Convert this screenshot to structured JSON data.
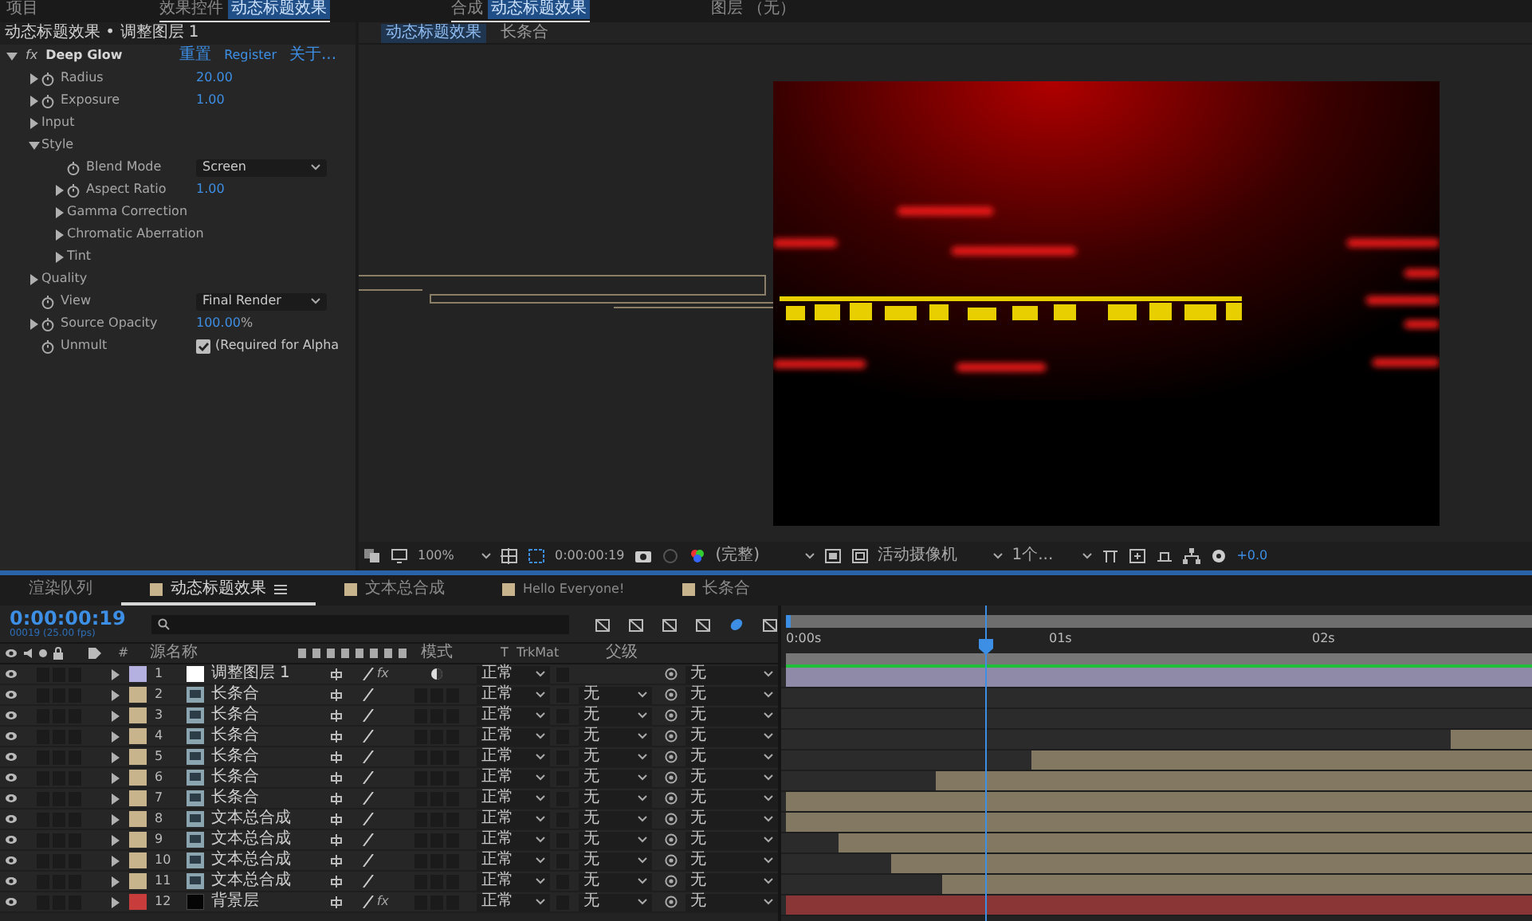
{
  "top_tabs": [
    {
      "label": "项目",
      "selected": false
    },
    {
      "label": "效果控件",
      "target": "动态标题效果",
      "selected": true
    },
    {
      "label": "合成",
      "target": "动态标题效果",
      "selected": true
    },
    {
      "label": "图层",
      "target": "（无）",
      "selected": false
    }
  ],
  "effect_controls": {
    "title": "动态标题效果 • 调整图层 1",
    "effect": {
      "badge": "fx",
      "name": "Deep Glow",
      "expanded": true,
      "links": [
        "重置",
        "Register",
        "关于..."
      ]
    },
    "properties": [
      {
        "kind": "number",
        "label": "Radius",
        "expanded": false,
        "stopwatch": true,
        "value": "20.00"
      },
      {
        "kind": "number",
        "label": "Exposure",
        "expanded": false,
        "stopwatch": true,
        "value": "1.00"
      },
      {
        "kind": "group",
        "label": "Input",
        "expanded": false
      },
      {
        "kind": "group",
        "label": "Style",
        "expanded": true,
        "children": [
          {
            "kind": "dropdown",
            "label": "Blend Mode",
            "stopwatch": true,
            "value": "Screen"
          },
          {
            "kind": "number",
            "label": "Aspect Ratio",
            "expanded": false,
            "stopwatch": true,
            "value": "1.00"
          },
          {
            "kind": "group",
            "label": "Gamma Correction",
            "expanded": false
          },
          {
            "kind": "group",
            "label": "Chromatic Aberration",
            "expanded": false
          },
          {
            "kind": "group",
            "label": "Tint",
            "expanded": false
          }
        ]
      },
      {
        "kind": "group",
        "label": "Quality",
        "expanded": false
      },
      {
        "kind": "dropdown",
        "label": "View",
        "stopwatch": true,
        "value": "Final Render"
      },
      {
        "kind": "number",
        "label": "Source Opacity",
        "expanded": false,
        "stopwatch": true,
        "value": "100.00",
        "unit": "%"
      },
      {
        "kind": "checkbox",
        "label": "Unmult",
        "stopwatch": true,
        "checked": true,
        "value": "(Required for Alpha"
      }
    ]
  },
  "viewer": {
    "tabs": [
      {
        "label": "动态标题效果",
        "selected": true
      },
      {
        "label": "长条合",
        "selected": false
      }
    ],
    "toolbar": {
      "zoom": "100%",
      "timecode": "0:00:00:19",
      "resolution": "(完整)",
      "camera": "活动摄像机",
      "views": "1个...",
      "exposure": "+0.0"
    }
  },
  "timeline": {
    "tabs": [
      {
        "label": "渲染队列",
        "selected": false
      },
      {
        "label": "动态标题效果",
        "selected": true,
        "color": "#c8b48c"
      },
      {
        "label": "文本总合成",
        "selected": false,
        "color": "#c8b48c"
      },
      {
        "label": "Hello Everyone!",
        "selected": false,
        "color": "#c8b48c"
      },
      {
        "label": "长条合",
        "selected": false,
        "color": "#c8b48c"
      }
    ],
    "timecode": "0:00:00:19",
    "frames": "00019 (25.00 fps)",
    "columns": {
      "number": "#",
      "name": "源名称",
      "mode": "模式",
      "t": "T",
      "trkmat": "TrkMat",
      "parent": "父级"
    },
    "ruler": [
      "0:00s",
      "01s",
      "02s"
    ],
    "playhead": {
      "level": 0.267
    },
    "layers": [
      {
        "number": "1",
        "name": "调整图层 1",
        "kind": "adjustment",
        "color": "#b4b0e0",
        "fx_switch": "fx",
        "mode": "正常",
        "parent": "无",
        "level": 1
      },
      {
        "number": "2",
        "name": "长条合",
        "kind": "precomp",
        "color": "#c8b48c",
        "mode": "正常",
        "trkmat": "无",
        "parent": "无"
      },
      {
        "number": "3",
        "name": "长条合",
        "kind": "precomp",
        "color": "#c8b48c",
        "mode": "正常",
        "trkmat": "无",
        "parent": "无"
      },
      {
        "number": "4",
        "name": "长条合",
        "kind": "precomp",
        "color": "#c8b48c",
        "mode": "正常",
        "trkmat": "无",
        "parent": "无",
        "level": 0.11
      },
      {
        "number": "5",
        "name": "长条合",
        "kind": "precomp",
        "color": "#c8b48c",
        "mode": "正常",
        "trkmat": "无",
        "parent": "无",
        "level": 0.67
      },
      {
        "number": "6",
        "name": "长条合",
        "kind": "precomp",
        "color": "#c8b48c",
        "mode": "正常",
        "trkmat": "无",
        "parent": "无",
        "level": 0.8
      },
      {
        "number": "7",
        "name": "长条合",
        "kind": "precomp",
        "color": "#c8b48c",
        "mode": "正常",
        "trkmat": "无",
        "parent": "无",
        "level": 1
      },
      {
        "number": "8",
        "name": "文本总合成",
        "kind": "precomp",
        "color": "#c8b48c",
        "mode": "正常",
        "trkmat": "无",
        "parent": "无",
        "level": 1
      },
      {
        "number": "9",
        "name": "文本总合成",
        "kind": "precomp",
        "color": "#c8b48c",
        "mode": "正常",
        "trkmat": "无",
        "parent": "无",
        "level": 0.93
      },
      {
        "number": "10",
        "name": "文本总合成",
        "kind": "precomp",
        "color": "#c8b48c",
        "mode": "正常",
        "trkmat": "无",
        "parent": "无",
        "level": 0.86
      },
      {
        "number": "11",
        "name": "文本总合成",
        "kind": "precomp",
        "color": "#c8b48c",
        "mode": "正常",
        "trkmat": "无",
        "parent": "无",
        "level": 0.79
      },
      {
        "number": "12",
        "name": "背景层",
        "kind": "solid",
        "color": "#c83c3c",
        "fx_switch": "fx",
        "mode": "正常",
        "trkmat": "无",
        "parent": "无",
        "level": 1
      }
    ]
  }
}
